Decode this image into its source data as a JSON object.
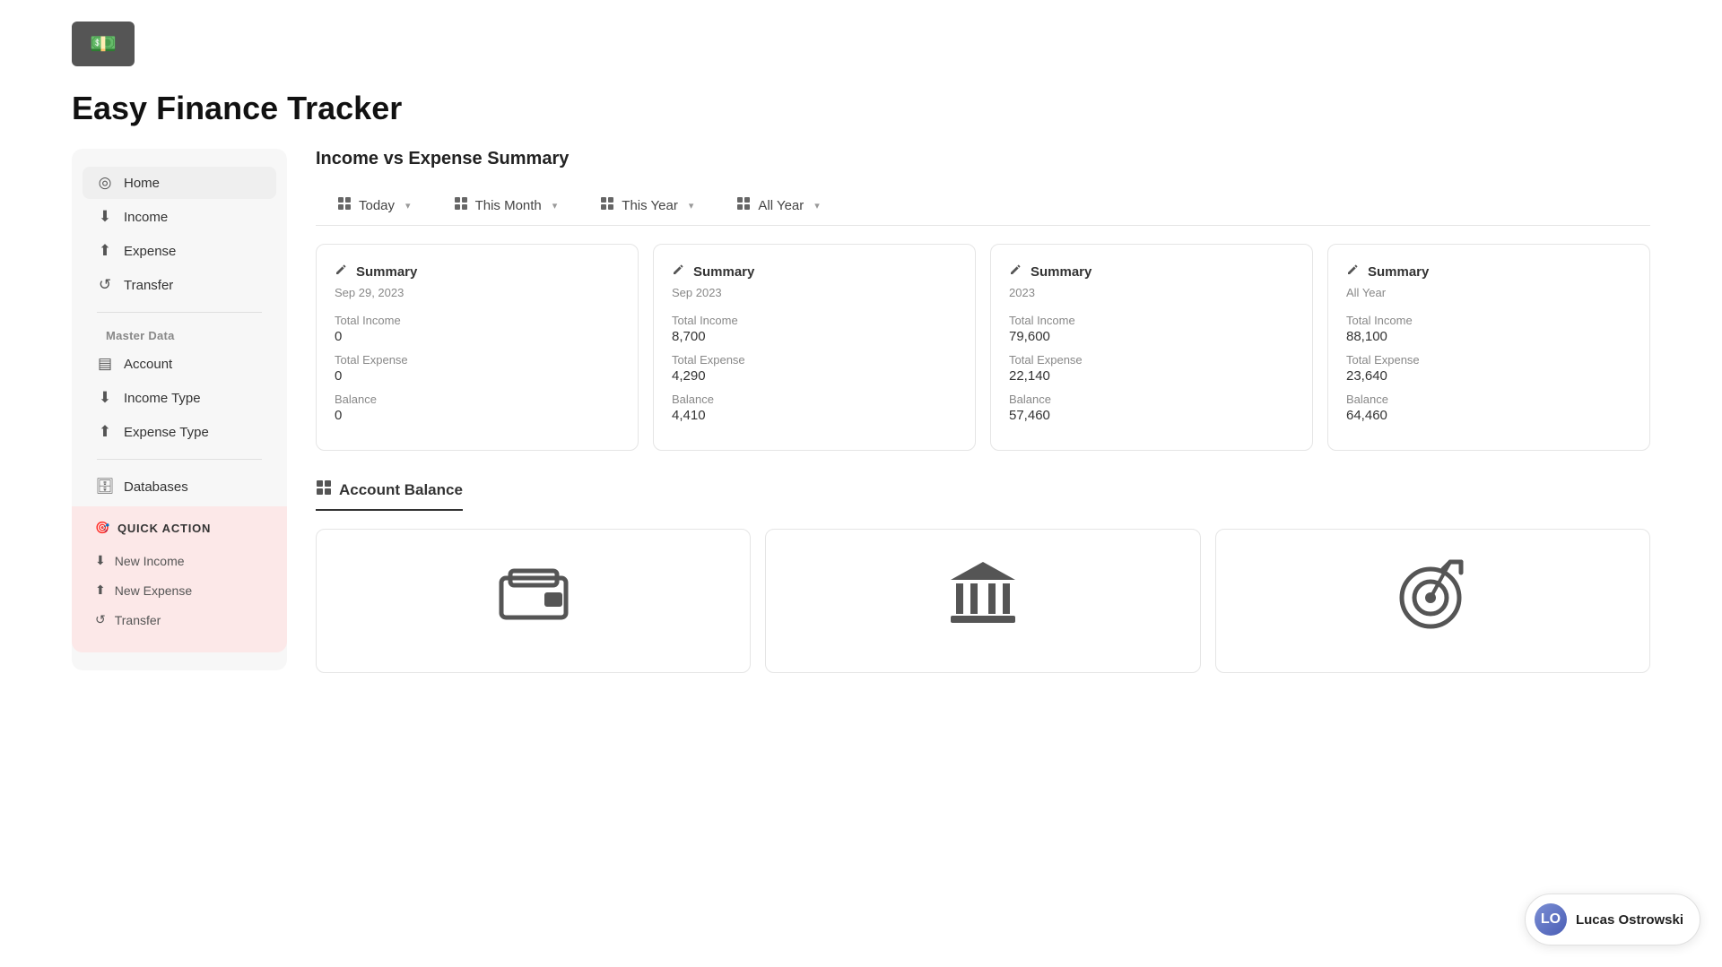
{
  "app": {
    "logo_icon": "💵",
    "title": "Easy Finance Tracker"
  },
  "sidebar": {
    "nav_items": [
      {
        "id": "home",
        "label": "Home",
        "icon": "◎",
        "active": true
      },
      {
        "id": "income",
        "label": "Income",
        "icon": "⬇"
      },
      {
        "id": "expense",
        "label": "Expense",
        "icon": "⬆"
      },
      {
        "id": "transfer",
        "label": "Transfer",
        "icon": "↺"
      }
    ],
    "master_data_title": "Master Data",
    "master_items": [
      {
        "id": "account",
        "label": "Account",
        "icon": "▤"
      },
      {
        "id": "income-type",
        "label": "Income Type",
        "icon": "⬇"
      },
      {
        "id": "expense-type",
        "label": "Expense Type",
        "icon": "⬆"
      }
    ],
    "databases_label": "Databases",
    "quick_action": {
      "title": "QUICK ACTION",
      "icon": "🎯",
      "items": [
        {
          "id": "new-income",
          "label": "New Income",
          "icon": "⬇"
        },
        {
          "id": "new-expense",
          "label": "New Expense",
          "icon": "⬆"
        },
        {
          "id": "new-transfer",
          "label": "Transfer",
          "icon": "↺"
        }
      ]
    }
  },
  "main": {
    "summary_section_title": "Income vs Expense Summary",
    "tabs": [
      {
        "id": "today",
        "label": "Today",
        "icon": "▦"
      },
      {
        "id": "this-month",
        "label": "This Month",
        "icon": "▦"
      },
      {
        "id": "this-year",
        "label": "This Year",
        "icon": "▦"
      },
      {
        "id": "all-year",
        "label": "All Year",
        "icon": "▦"
      }
    ],
    "summary_cards": [
      {
        "id": "today",
        "header_icon": "▦",
        "header_label": "Summary",
        "date": "Sep 29, 2023",
        "total_income_label": "Total Income",
        "total_income_value": "0",
        "total_expense_label": "Total Expense",
        "total_expense_value": "0",
        "balance_label": "Balance",
        "balance_value": "0"
      },
      {
        "id": "this-month",
        "header_icon": "▦",
        "header_label": "Summary",
        "date": "Sep 2023",
        "total_income_label": "Total Income",
        "total_income_value": "8,700",
        "total_expense_label": "Total Expense",
        "total_expense_value": "4,290",
        "balance_label": "Balance",
        "balance_value": "4,410"
      },
      {
        "id": "this-year",
        "header_icon": "▦",
        "header_label": "Summary",
        "date": "2023",
        "total_income_label": "Total Income",
        "total_income_value": "79,600",
        "total_expense_label": "Total Expense",
        "total_expense_value": "22,140",
        "balance_label": "Balance",
        "balance_value": "57,460"
      },
      {
        "id": "all-year",
        "header_icon": "▦",
        "header_label": "Summary",
        "date": "All Year",
        "total_income_label": "Total Income",
        "total_income_value": "88,100",
        "total_expense_label": "Total Expense",
        "total_expense_value": "23,640",
        "balance_label": "Balance",
        "balance_value": "64,460"
      }
    ],
    "account_balance_title": "Account Balance",
    "account_balance_icon": "▦",
    "balance_cards": [
      {
        "id": "wallet",
        "icon": "🏧"
      },
      {
        "id": "bank",
        "icon": "🏛"
      },
      {
        "id": "target",
        "icon": "🎯"
      }
    ]
  },
  "user": {
    "name": "Lucas Ostrowski",
    "avatar_initials": "LO"
  }
}
